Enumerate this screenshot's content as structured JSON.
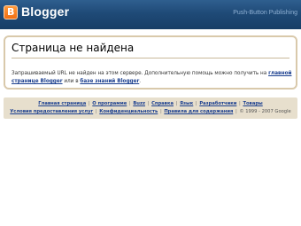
{
  "header": {
    "logo_text": "Blogger",
    "tagline": "Push-Button Publishing",
    "colors": {
      "header_top": "#2f5f8f",
      "header_bottom": "#173e66",
      "logo_orange": "#f06e12"
    }
  },
  "content": {
    "title": "Страница не найдена",
    "message_prefix": "Запрашиваемый URL не найден на этом сервере. Дополнительную помощь можно получить на ",
    "link_home_line1": "главной",
    "link_home_line2": "странице Blogger",
    "message_middle": " или в ",
    "link_kb": "базе знаний Blogger",
    "message_suffix": "."
  },
  "footer": {
    "line1_links": [
      "Главная страница",
      "О программе",
      "Buzz",
      "Справка",
      "Язык",
      "Разработчики",
      "Товары"
    ],
    "line2_links": [
      "Условия предоставления услуг",
      "Конфиденциальность",
      "Правила для содержания"
    ],
    "copyright": "© 1999 - 2007 Google"
  }
}
